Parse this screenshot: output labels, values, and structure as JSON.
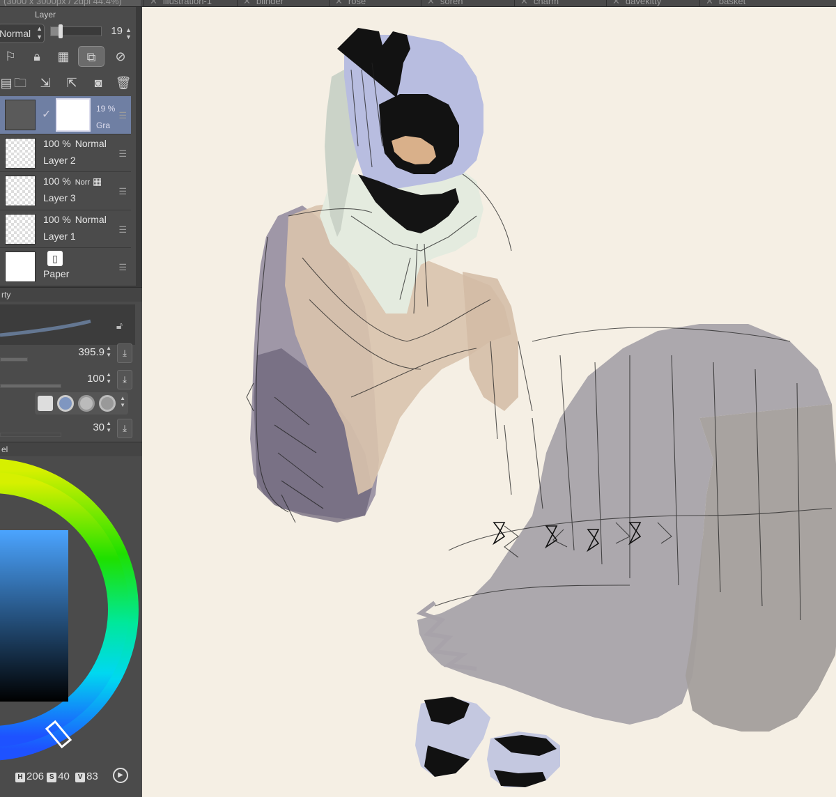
{
  "doc_tabs": [
    {
      "label": "(3000 x 3000px / 2dpi 44.4%)",
      "active": true
    },
    {
      "label": "illustration-1"
    },
    {
      "label": "blinder"
    },
    {
      "label": "rose"
    },
    {
      "label": "soren"
    },
    {
      "label": "charm"
    },
    {
      "label": "davekitty"
    },
    {
      "label": "basket"
    }
  ],
  "layer_panel": {
    "title": "Layer",
    "blend_mode": "Normal",
    "opacity": "19",
    "opacity_fraction": 0.19,
    "layers": [
      {
        "opacity": "19 %",
        "mode": "Gra",
        "name": "",
        "selected": true,
        "type": "gradient"
      },
      {
        "opacity": "100 %",
        "mode": "Normal",
        "name": "Layer 2",
        "type": "raster"
      },
      {
        "opacity": "100 %",
        "mode": "Norr",
        "name": "Layer 3",
        "type": "raster"
      },
      {
        "opacity": "100 %",
        "mode": "Normal",
        "name": "Layer 1",
        "type": "raster"
      },
      {
        "opacity": "",
        "mode": "",
        "name": "Paper",
        "type": "paper"
      }
    ]
  },
  "tool_property": {
    "title": "rty",
    "brush_size": "395.9",
    "opacity": "100",
    "setting3": "30"
  },
  "color_panel": {
    "title": "el",
    "h_label": "H",
    "h": "206",
    "s_label": "S",
    "s": "40",
    "v_label": "V",
    "v": "83"
  },
  "colors": {
    "canvas_bg": "#f5efe4",
    "selected_layer": "#6f7fa3",
    "current_color": "#4a9be8"
  }
}
